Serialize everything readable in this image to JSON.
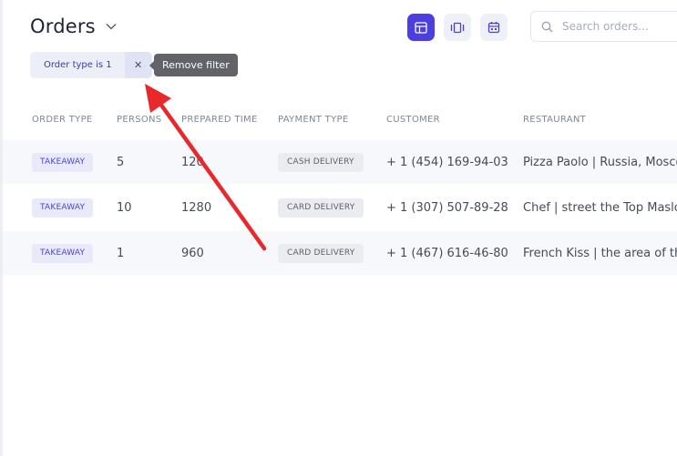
{
  "header": {
    "title": "Orders"
  },
  "search": {
    "placeholder": "Search orders..."
  },
  "filter": {
    "chip_label": "Order type is 1",
    "remove_symbol": "✕",
    "tooltip": "Remove filter"
  },
  "table": {
    "columns": [
      "ORDER TYPE",
      "PERSONS",
      "PREPARED TIME",
      "PAYMENT TYPE",
      "CUSTOMER",
      "RESTAURANT"
    ],
    "rows": [
      {
        "order_type": "TAKEAWAY",
        "persons": "5",
        "prepared_time": "120",
        "payment": "CASH DELIVERY",
        "customer": "+ 1 (454) 169-94-03",
        "restaurant": "Pizza Paolo | Russia, Moscow"
      },
      {
        "order_type": "TAKEAWAY",
        "persons": "10",
        "prepared_time": "1280",
        "payment": "CARD DELIVERY",
        "customer": "+ 1 (307) 507-89-28",
        "restaurant": "Chef | street the Top Maslovka"
      },
      {
        "order_type": "TAKEAWAY",
        "persons": "1",
        "prepared_time": "960",
        "payment": "CARD DELIVERY",
        "customer": "+ 1 (467) 616-46-80",
        "restaurant": "French Kiss | the area of the"
      }
    ]
  },
  "colors": {
    "accent": "#4b3fe0",
    "annotation_arrow": "#e8282b"
  }
}
